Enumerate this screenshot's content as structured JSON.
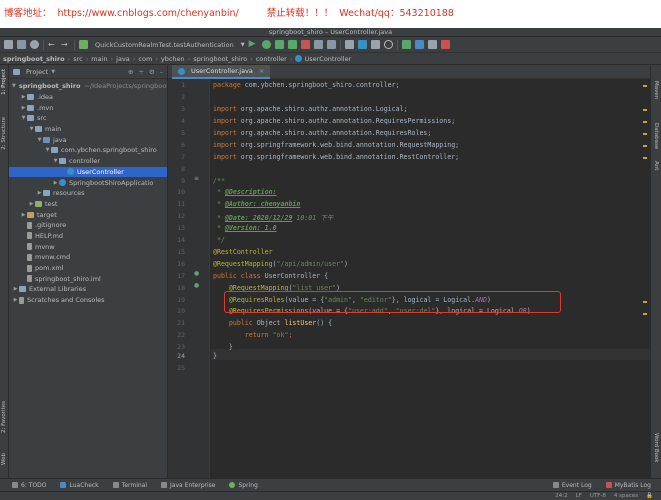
{
  "banner": {
    "blog_label": "博客地址：",
    "blog_url": "https://www.cnblogs.com/chenyanbin/",
    "notice": "禁止转载！！！",
    "contact_label": "Wechat/qq：",
    "contact_value": "543210188"
  },
  "window_title": "springboot_shiro – UserController.java",
  "toolbar": {
    "run_config": "QuickCustomRealmTest.testAuthentication"
  },
  "breadcrumbs": [
    "springboot_shiro",
    "src",
    "main",
    "java",
    "com",
    "ybchen",
    "springboot_shiro",
    "controller",
    "UserController"
  ],
  "left_strip": {
    "project": "1: Project",
    "structure": "2: Structure",
    "favorites": "2: Favorites",
    "web": "Web"
  },
  "right_strip": {
    "maven": "Maven",
    "database": "Database",
    "ant": "Ant",
    "wordbook": "Word Book"
  },
  "project_panel": {
    "title": "Project",
    "tree": [
      {
        "label": "springboot_shiro",
        "extra": "~/IdeaProjects/springboot",
        "level": 0,
        "expanded": true,
        "icon": "folder",
        "bold": true
      },
      {
        "label": ".idea",
        "level": 1,
        "expanded": false,
        "icon": "folder"
      },
      {
        "label": ".mvn",
        "level": 1,
        "expanded": false,
        "icon": "folder"
      },
      {
        "label": "src",
        "level": 1,
        "expanded": true,
        "icon": "folder"
      },
      {
        "label": "main",
        "level": 2,
        "expanded": true,
        "icon": "folder"
      },
      {
        "label": "java",
        "level": 3,
        "expanded": true,
        "icon": "folder-src"
      },
      {
        "label": "com.ybchen.springboot_shiro",
        "level": 4,
        "expanded": true,
        "icon": "folder"
      },
      {
        "label": "controller",
        "level": 5,
        "expanded": true,
        "icon": "folder"
      },
      {
        "label": "UserController",
        "level": 6,
        "icon": "class",
        "selected": true
      },
      {
        "label": "SpringbootShiroApplicatio",
        "level": 5,
        "icon": "class",
        "collapsed_arrow": true
      },
      {
        "label": "resources",
        "level": 3,
        "expanded": false,
        "icon": "folder-res"
      },
      {
        "label": "test",
        "level": 2,
        "expanded": false,
        "icon": "folder-test"
      },
      {
        "label": "target",
        "level": 1,
        "expanded": false,
        "icon": "folder-ex"
      },
      {
        "label": ".gitignore",
        "level": 1,
        "icon": "file"
      },
      {
        "label": "HELP.md",
        "level": 1,
        "icon": "file"
      },
      {
        "label": "mvnw",
        "level": 1,
        "icon": "file"
      },
      {
        "label": "mvnw.cmd",
        "level": 1,
        "icon": "file"
      },
      {
        "label": "pom.xml",
        "level": 1,
        "icon": "file"
      },
      {
        "label": "springboot_shiro.iml",
        "level": 1,
        "icon": "file"
      },
      {
        "label": "External Libraries",
        "level": 0,
        "expanded": false,
        "icon": "lib"
      },
      {
        "label": "Scratches and Consoles",
        "level": 0,
        "expanded": false,
        "icon": "scratch"
      }
    ]
  },
  "editor": {
    "tab": "UserController.java",
    "line_numbers": [
      "1",
      "2",
      "3",
      "4",
      "5",
      "6",
      "7",
      "8",
      "9",
      "10",
      "11",
      "12",
      "13",
      "14",
      "15",
      "16",
      "17",
      "18",
      "19",
      "20",
      "21",
      "22",
      "23",
      "24",
      "25"
    ],
    "code": {
      "l1_kw": "package",
      "l1_rest": " com.ybchen.springboot_shiro.controller;",
      "l3_kw": "import",
      "l3_rest": " org.apache.shiro.authz.annotation.Logical;",
      "l4_kw": "import",
      "l4_rest": " org.apache.shiro.authz.annotation.RequiresPermissions;",
      "l5_kw": "import",
      "l5_rest": " org.apache.shiro.authz.annotation.RequiresRoles;",
      "l6_kw": "import",
      "l6_rest": " org.springframework.web.bind.annotation.RequestMapping;",
      "l7_kw": "import",
      "l7_rest": " org.springframework.web.bind.annotation.RestController;",
      "l9": "/**",
      "l10_tag": "@Description:",
      "l11_tag": "@Author:",
      "l11_val": " chenyanbin",
      "l12_tag": "@Date:",
      "l12_val": " 2020/12/29",
      "l12_time": " 10:01",
      "l12_suffix": " 下午",
      "l13_tag": "@Version:",
      "l13_val": " 1.0",
      "l14": " */",
      "l15_ann": "@RestController",
      "l16_ann": "@RequestMapping",
      "l16_open": "(",
      "l16_str": "\"/api/admin/user\"",
      "l16_close": ")",
      "l17_kw": "public class",
      "l17_rest": " UserController {",
      "l18_ann": "@RequestMapping",
      "l18_open": "(",
      "l18_str": "\"list_user\"",
      "l18_close": ")",
      "l19_ann": "@RequiresRoles",
      "l19_a": "(value = {",
      "l19_s1": "\"admin\"",
      "l19_b": ", ",
      "l19_s2": "\"editor\"",
      "l19_c": "}, logical = Logical.",
      "l19_d": "AND",
      "l19_e": ")",
      "l20_ann": "@RequiresPermissions",
      "l20_a": "(value = {",
      "l20_s1": "\"user:add\"",
      "l20_b": ", ",
      "l20_s2": "\"user:del\"",
      "l20_c": "}, logical = Logical.",
      "l20_d": "OR",
      "l20_e": ")",
      "l21_kw": "public",
      "l21_type": " Object ",
      "l21_method": "listUser",
      "l21_rest": "() {",
      "l22_kw": "return",
      "l22_str": " \"ok\"",
      "l22_rest": ";",
      "l23": "}",
      "l24": "}"
    }
  },
  "bottom_tools": {
    "todo": "6: TODO",
    "luacheck": "LuaCheck",
    "terminal": "Terminal",
    "java_enterprise": "Java Enterprise",
    "spring": "Spring",
    "event_log": "Event Log",
    "mybatis_log": "MyBatis Log"
  },
  "status": {
    "position": "24:2",
    "line_sep": "LF",
    "encoding": "UTF-8",
    "indent": "4 spaces"
  },
  "colors": {
    "highlight_border": "#e03a2a",
    "selection": "#2f65ca",
    "banner_text": "#e0301e"
  }
}
